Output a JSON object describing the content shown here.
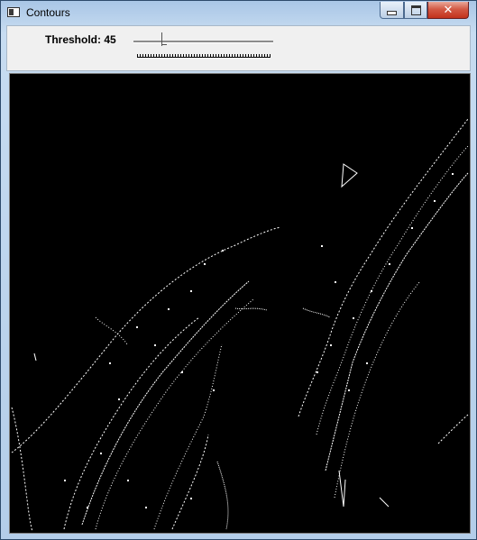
{
  "window": {
    "title": "Contours",
    "icon": "app-window-icon",
    "controls": [
      "minimize-icon",
      "maximize-icon",
      "close-icon"
    ]
  },
  "toolbar": {
    "threshold_label": "Threshold: 45",
    "threshold_value": 45,
    "slider_min": 0,
    "slider_max": 255
  },
  "canvas": {
    "background": "#000000",
    "contour_color": "#ffffff"
  }
}
